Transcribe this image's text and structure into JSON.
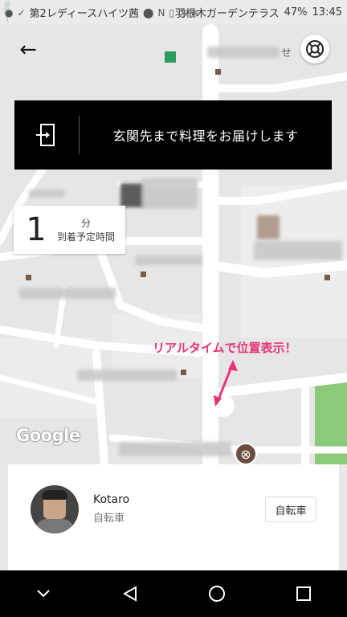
{
  "status_bar": {
    "carrier": "第2レディースハイツ茜",
    "location_right": "羽根木ガーデンテラス",
    "battery": "47%",
    "time": "13:45"
  },
  "map": {
    "store_label_fragment": "せ",
    "google_logo": "Google"
  },
  "banner": {
    "message": "玄関先まで料理をお届けします"
  },
  "eta": {
    "minutes": "1",
    "unit": "分",
    "label": "到着予定時間"
  },
  "callout": {
    "text": "リアルタイムで位置表示！"
  },
  "courier": {
    "name": "Kotaro",
    "vehicle": "自転車",
    "vehicle_button": "自転車"
  },
  "colors": {
    "callout": "#e8347a",
    "park": "#8bc97b",
    "banner_bg": "#000000"
  }
}
